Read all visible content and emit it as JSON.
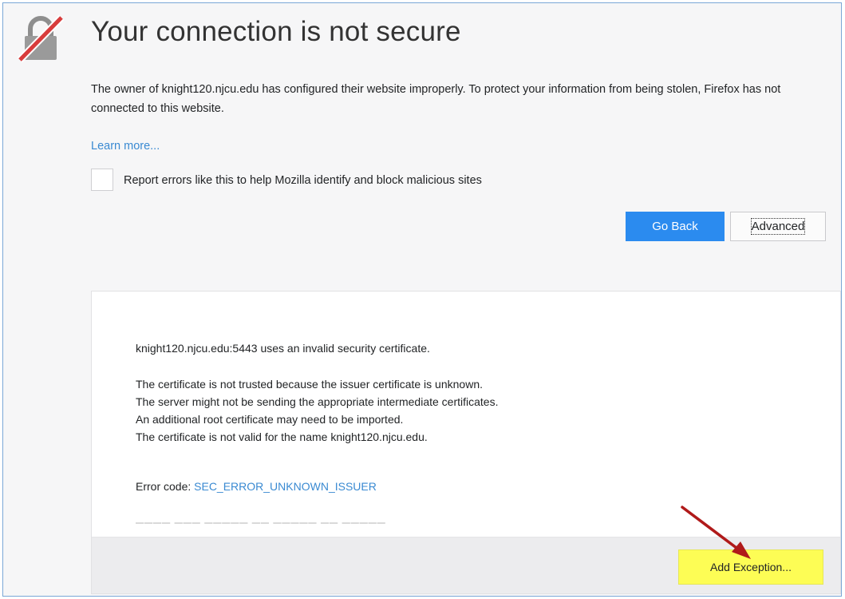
{
  "page": {
    "title": "Your connection is not secure",
    "intro": "The owner of knight120.njcu.edu has configured their website improperly. To protect your information from being stolen, Firefox has not connected to this website.",
    "learn_more": "Learn more...",
    "report_label": "Report errors like this to help Mozilla identify and block malicious sites",
    "report_checked": false
  },
  "buttons": {
    "go_back": "Go Back",
    "advanced": "Advanced",
    "add_exception": "Add Exception..."
  },
  "advanced": {
    "host_message": "knight120.njcu.edu:5443 uses an invalid security certificate.",
    "details": [
      "The certificate is not trusted because the issuer certificate is unknown.",
      "The server might not be sending the appropriate intermediate certificates.",
      "An additional root certificate may need to be imported.",
      "The certificate is not valid for the name knight120.njcu.edu."
    ],
    "error_prefix": "Error code: ",
    "error_code": "SEC_ERROR_UNKNOWN_ISSUER"
  },
  "icons": {
    "lock": "broken-lock-icon",
    "arrow": "annotation-arrow-icon"
  },
  "colors": {
    "accent_blue": "#2b8bef",
    "link_blue": "#3a8ad2",
    "highlight_yellow": "#fdfd55",
    "annotation_red": "#b01a1a",
    "warning_slash": "#d83c3c"
  }
}
